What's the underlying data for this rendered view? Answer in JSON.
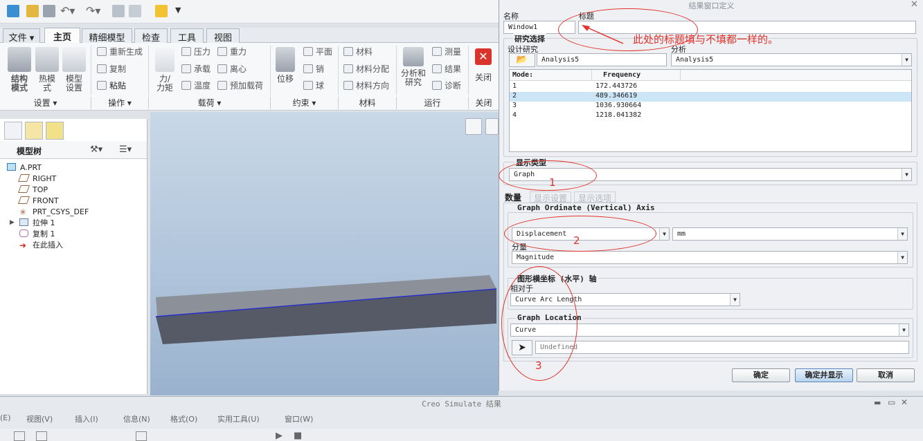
{
  "quick_access": {
    "icons": [
      "new-icon",
      "open-icon",
      "save-icon",
      "undo-icon",
      "redo-icon",
      "regenerate-icon",
      "windows-icon",
      "folder-icon",
      "customize-icon"
    ]
  },
  "tabs": [
    {
      "label": "文件 ▾"
    },
    {
      "label": "主页"
    },
    {
      "label": "精细模型"
    },
    {
      "label": "检查"
    },
    {
      "label": "工具"
    },
    {
      "label": "视图"
    }
  ],
  "ribbon": {
    "structure_mode": "结构\n模式",
    "thermal_mode": "热模\n式",
    "model_setup": "模型\n设置",
    "regenerate": "重新生成",
    "copy": "复制",
    "paste": "粘贴",
    "force_moment": "力/\n力矩",
    "pressure": "压力",
    "bearing": "承载",
    "temperature": "温度",
    "gravity": "重力",
    "centrifugal": "离心",
    "preload": "预加载荷",
    "displacement": "位移",
    "plane": "平面",
    "pin": "销",
    "ball": "球",
    "material": "材料",
    "material_assign": "材料分配",
    "material_orient": "材料方向",
    "analysis_study": "分析和\n研究",
    "measure": "测量",
    "results": "结果",
    "diagnose": "诊断",
    "close": "关闭",
    "groups": [
      "设置 ▾",
      "操作 ▾",
      "载荷 ▾",
      "约束 ▾",
      "材料",
      "运行",
      "关闭"
    ]
  },
  "model_tree": {
    "title": "模型树",
    "items": [
      "A.PRT",
      "RIGHT",
      "TOP",
      "FRONT",
      "PRT_CSYS_DEF",
      "拉伸 1",
      "复制 1",
      "在此插入"
    ]
  },
  "dialog": {
    "title": "结果窗口定义",
    "name_label": "名称",
    "name_value": "Window1",
    "title_label": "标题",
    "title_value": "",
    "study_group": "研究选择",
    "design_study_label": "设计研究",
    "design_study_value": "Analysis5",
    "analysis_label": "分析",
    "analysis_value": "Analysis5",
    "modes_header": [
      "Mode:",
      "Frequency"
    ],
    "modes": [
      {
        "mode": "1",
        "freq": "172.443726"
      },
      {
        "mode": "2",
        "freq": "489.346619"
      },
      {
        "mode": "3",
        "freq": "1036.930664"
      },
      {
        "mode": "4",
        "freq": "1218.041382"
      }
    ],
    "display_type_label": "显示类型",
    "display_type_value": "Graph",
    "subtabs": [
      "数量",
      "显示设置",
      "显示选项"
    ],
    "ordinate_group": "Graph Ordinate (Vertical) Axis",
    "quantity_value": "Displacement",
    "unit_value": "mm",
    "component_label": "分量",
    "component_value": "Magnitude",
    "abscissa_group": "图形横坐标 (水平) 轴",
    "relative_label": "相对于",
    "relative_value": "Curve Arc Length",
    "location_group": "Graph Location",
    "location_value": "Curve",
    "undefined_placeholder": "Undefined",
    "ok": "确定",
    "ok_show": "确定并显示",
    "cancel": "取消"
  },
  "annotations": {
    "note": "此处的标题填与不填都一样的。",
    "n1": "1",
    "n2": "2",
    "n3": "3"
  },
  "bottom_window": {
    "title": "Creo Simulate 结果",
    "menus": [
      "(E)",
      "视图(V)",
      "插入(I)",
      "信息(N)",
      "格式(O)",
      "实用工具(U)",
      "窗口(W)"
    ]
  },
  "colors": {
    "accent": "#3a6ea5",
    "annotation": "#e3322b",
    "selected_row": "#cde6f7"
  }
}
